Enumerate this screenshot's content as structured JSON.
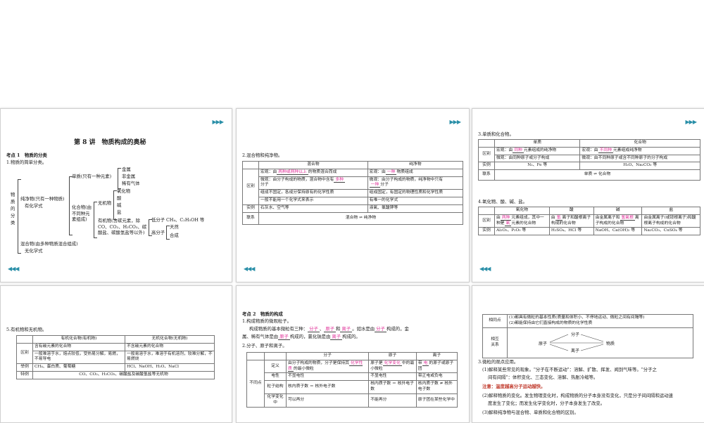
{
  "s1": {
    "title": "第 8 讲　物质构成的奥秘",
    "kp": "考点 1　物质的分类",
    "q1": "1.物质的简单分类。",
    "root": "物\n质\n的\n分\n类",
    "pure": "纯净物(只有一种物质)",
    "pure2": "有化学式",
    "simple": "单质(只有一种元素)",
    "metal": "金属",
    "nonmetal": "非金属",
    "gas": "稀有气体",
    "compound": "化合物(由\n不同种元\n素组成)",
    "inorganic": "无机物",
    "oxide": "氧化物",
    "acid": "酸",
    "base": "碱",
    "salt": "盐",
    "organic": "有机物(含碳元素，除\nCO、CO₂、H₂CO₃、碳\n酸盐、碳酸氢盐等以外)",
    "lowmol": "低分子",
    "lowmol_ex": "CH₄、C₂H₅OH 等",
    "highmol": "高分子",
    "nat": "天然",
    "syn": "合成",
    "mix": "混合物(由多种物质混合组成)",
    "mix2": "无化学式"
  },
  "s2": {
    "q": "2.混合物和纯净物。",
    "h1": "混合物",
    "h2": "纯净物",
    "rowlabel": "区别",
    "r1a_pre": "宏观：由",
    "r1a_ans": "两种或两种以上",
    "r1a_post": "的物质混合而成",
    "r1b_pre": "宏观：由",
    "r1b_ans": "一种",
    "r1b_post": "物质组成",
    "r2a_pre": "微观：由分子构成的物质，混合物中含有",
    "r2a_ans": "多种",
    "r2a_post": "分子",
    "r2b_pre": "微观：由分子构成的物质，纯净物中只有",
    "r2b_ans": "一种",
    "r2b_post": "分子",
    "r3a": "组成不固定，各成分保持原有的化学性质",
    "r3b": "组成固定，有固定的物理性质和化学性质",
    "r4a": "一般不能用一个化学式来表示",
    "r4b": "有唯一的化学式",
    "exlabel": "实例",
    "exa": "石灰水、空气等",
    "exb": "液氧、氯酸钾等",
    "linklabel": "联系",
    "link": "混合物 ⇌ 纯净物"
  },
  "s3": {
    "q3": "3.单质和化合物。",
    "h1": "单质",
    "h2": "化合物",
    "diff": "区别",
    "r1a_pre": "宏观：由",
    "r1a_ans": "同种",
    "r1a_post": "元素组成的纯净物",
    "r1b_pre": "宏观：由",
    "r1b_ans": "不同种",
    "r1b_post": "元素组成纯净物",
    "r2a": "微观：由同种原子或分子构成",
    "r2b": "微观：由不同种原子或含不同种原子的分子构成",
    "ex": "实例",
    "exa": "N₂、Fe 等",
    "exb": "H₂O、Na₂CO₃ 等",
    "link": "联系",
    "linktext": "单质 ⇌ 化合物",
    "q4": "4.氧化物、酸、碱、盐。",
    "t2h": [
      "氧化物",
      "酸",
      "碱",
      "盐"
    ],
    "o_pre": "由",
    "o_ans": "两种",
    "o_mid": "元素组成，其中一种是",
    "o_ans2": "氧",
    "o_post": "元素的化合物",
    "a_pre": "由",
    "a_ans": "氢",
    "a_post": "离子和酸根离子构成的化合物",
    "b_pre": "由金属离子和",
    "b_ans": "氢氧根",
    "b_post": "离子构成的化合物",
    "s_txt": "由金属离子(或铵根离子)和酸根离子构成的化合物",
    "exo": "Al₂O₃、P₂O₅ 等",
    "exa2": "H₂SO₄、HCl 等",
    "exb2": "NaOH、Ca(OH)₂ 等",
    "exs": "Na₂CO₃、CuSO₄ 等"
  },
  "s4": {
    "q": "5.有机物和无机物。",
    "h1": "有机化合物(有机物)",
    "h2": "无机化合物(无机物)",
    "diff": "区别",
    "r1a": "含有碳元素的化合物",
    "r1b": "不含碳元素的化合物",
    "r2a": "一般难溶于水，熔点较低，受热易分解，易燃，不易导电",
    "r2b": "一般易溶于水，难溶于有机溶剂，较难分解，不易燃烧",
    "ex": "举例",
    "exa": "CH₄、蛋白质、葡萄糖",
    "exb": "HCl、NaOH、H₂O、NaCl",
    "sp": "特例",
    "spt": "CO、CO₂、H₂CO₃、碳酸盐及碳酸氢盐等无机物"
  },
  "s5": {
    "kp": "考点 2　物质的构成",
    "q1": "1.构成物质的微观粒子。",
    "l1_pre": "构成物质的基本微粒有三种：",
    "ans1": "分子",
    "ans2": "原子",
    "ans3": "离子",
    "l1_mid": "。如水是由",
    "ans4": "分子",
    "l1_post": "构成的，金",
    "l2_pre": "属、稀有气体是由",
    "ans5": "原子",
    "l2_mid": "构成的，氯化钠是由",
    "ans6": "离子",
    "l2_post": "构成的。",
    "q2": "2.分子、原子和离子。",
    "th": [
      "分子",
      "原子",
      "离子"
    ],
    "notsame": "不同点",
    "def": "定义",
    "def_a": "由分子构成的物质，分子是保持其",
    "def_a_ans": "化学性质",
    "def_a_post": "的最小微粒",
    "def_b_pre": "原子是",
    "def_b_ans": "化学变化",
    "def_b_post": "中的最小微粒",
    "def_c_pre": "带",
    "def_c_ans": "电",
    "def_c_post": "的原子或原子团",
    "elec": "电性",
    "elec_a": "不显电性",
    "elec_b": "不显电性",
    "elec_c": "带正电或负电",
    "struct": "粒子结构",
    "st_a": "核内质子数 ＝ 核外电子数",
    "st_b": "核内质子数 ＝ 核外电子数",
    "st_c": "核内质子数 ≠ 核外电子数",
    "chem": "化学变化中",
    "ch_a": "可以再分",
    "ch_b": "不能再分",
    "ch_c": "原子团在某些化学中"
  },
  "s6": {
    "same": "相同点",
    "same1": "(1)都具有微粒的基本性质(质量和体积小、不停地运动、微粒之间有间隔等)",
    "same2": "(2)都能保持由它们直接构成的物质的化学性质",
    "rel": "相互\n关系",
    "atom": "原子",
    "mol": "分子",
    "ion": "离子",
    "mat": "物质",
    "q3": "3.微粒的观点应用。",
    "p1": "(1)解释某些常见的现象。\"分子在不断运动\"：溶解、扩散、挥发、闻到气味等。\"分子之",
    "p1b": "间有间隔\"：体积变化、三态变化、溶解、热胀冷缩等。",
    "note": "注意：温度越高分子运动越快。",
    "p2": "(2)解释物质的变化。发生物理变化时，构成物质的分子本身没有变化，只是分子间间隔和运动速",
    "p2b": "度发生了变化；而发生化学变化时，分子本身发生了改变。",
    "p3": "(3)解释纯净物与混合物、单质和化合物的区别。"
  },
  "nav": {
    "next": "▶▶▶",
    "prev": "◀◀◀"
  }
}
